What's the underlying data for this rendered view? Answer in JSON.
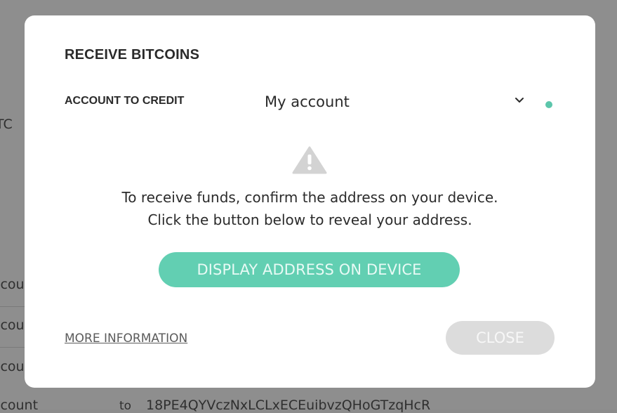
{
  "background": {
    "fragments": [
      "TC",
      "ccou",
      "ccou",
      "ccou",
      "ccount",
      "to",
      "18PE4QYVczNxLCLxECEuibvzQHoGTzqHcR"
    ]
  },
  "dialog": {
    "title": "RECEIVE BITCOINS",
    "account_label": "ACCOUNT TO CREDIT",
    "account_value": "My account",
    "account_status_color": "#5cc6ab",
    "warning_icon": "warning-triangle-icon",
    "message_line1": "To receive funds, confirm the address on your device.",
    "message_line2": "Click the button below to reveal your address.",
    "display_button_label": "DISPLAY ADDRESS ON DEVICE",
    "more_info_link": "MORE INFORMATION",
    "close_button_label": "CLOSE"
  },
  "colors": {
    "accent": "#62cfb2",
    "disabled": "#dcdcdc",
    "overlay": "#8e8e8e"
  }
}
